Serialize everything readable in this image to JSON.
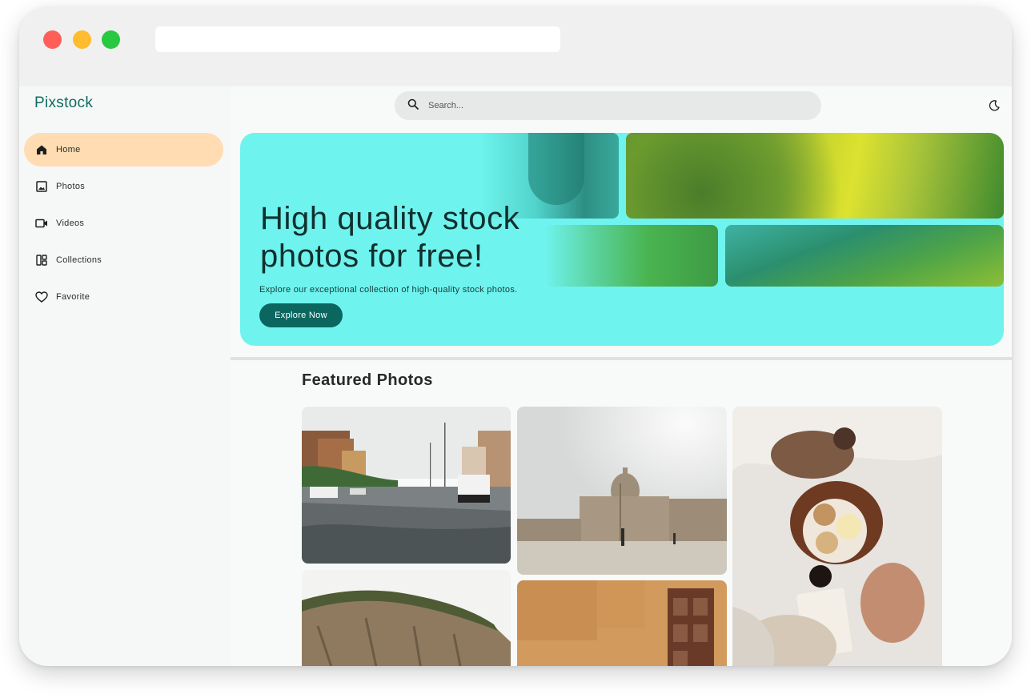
{
  "app": {
    "logo": "Pixstock"
  },
  "sidebar": {
    "items": [
      {
        "label": "Home",
        "icon": "home-icon",
        "active": true
      },
      {
        "label": "Photos",
        "icon": "image-icon",
        "active": false
      },
      {
        "label": "Videos",
        "icon": "video-icon",
        "active": false
      },
      {
        "label": "Collections",
        "icon": "collections-icon",
        "active": false
      },
      {
        "label": "Favorite",
        "icon": "heart-icon",
        "active": false
      }
    ]
  },
  "header": {
    "search_placeholder": "Search...",
    "theme_icon": "moon-icon"
  },
  "hero": {
    "title": "High quality stock photos for free!",
    "subtitle": "Explore our exceptional collection of high-quality stock photos.",
    "button_label": "Explore Now"
  },
  "featured": {
    "title": "Featured Photos"
  },
  "colors": {
    "brand": "#0d6b63",
    "hero_bg": "#6ff3ee",
    "active_nav": "#ffdcb2",
    "button": "#0b6660"
  }
}
